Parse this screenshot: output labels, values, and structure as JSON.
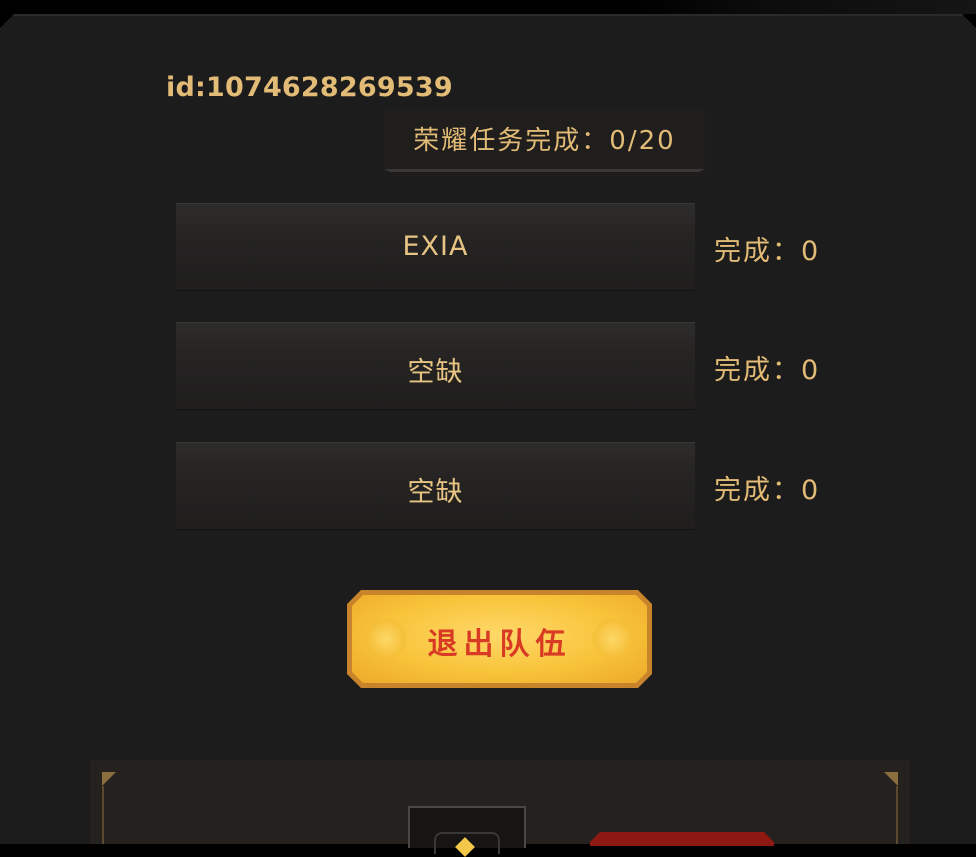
{
  "player": {
    "id_text": "id:1074628269539"
  },
  "honor_task": {
    "label": "荣耀任务完成：0/20"
  },
  "team_slots": [
    {
      "name": "EXIA",
      "done_label": "完成：0"
    },
    {
      "name": "空缺",
      "done_label": "完成：0"
    },
    {
      "name": "空缺",
      "done_label": "完成：0"
    }
  ],
  "actions": {
    "quit_team_label": "退出队伍"
  },
  "colors": {
    "gold_text": "#e2bb76",
    "button_fill": "#f8c43a",
    "button_text": "#d83a24",
    "panel_bg": "#1d1c1c"
  }
}
